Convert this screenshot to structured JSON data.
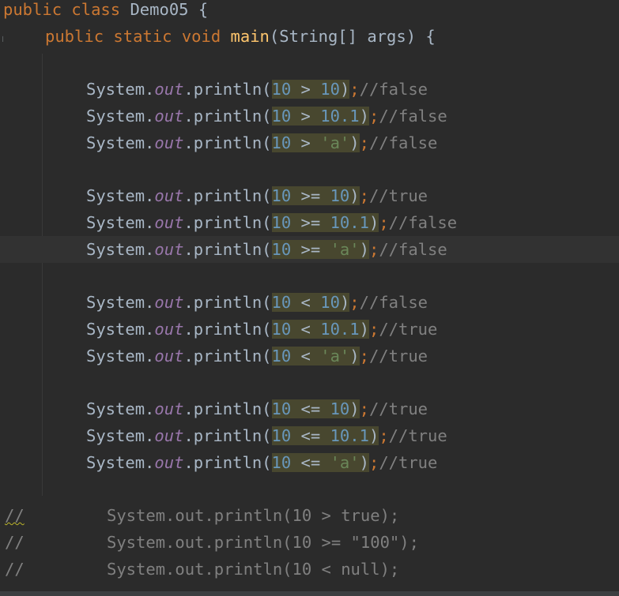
{
  "editor": {
    "class_decl": {
      "kw_public": "public",
      "kw_class": "class",
      "name": " Demo05 ",
      "brace": "{"
    },
    "main_decl": {
      "kw_public": "public",
      "kw_static": "static",
      "kw_void": "void",
      "name": "main",
      "params": "(String[] args) {"
    },
    "lines": [
      {
        "recv": "System.",
        "field": "out",
        "call": ".println(",
        "lhs": "10",
        "op": " > ",
        "rhs": "10",
        "rhs_type": "num",
        "close": ")",
        "semi": ";",
        "comment": "//false"
      },
      {
        "recv": "System.",
        "field": "out",
        "call": ".println(",
        "lhs": "10",
        "op": " > ",
        "rhs": "10.1",
        "rhs_type": "num",
        "close": ")",
        "semi": ";",
        "comment": "//false"
      },
      {
        "recv": "System.",
        "field": "out",
        "call": ".println(",
        "lhs": "10",
        "op": " > ",
        "rhs": "'a'",
        "rhs_type": "str",
        "close": ")",
        "semi": ";",
        "comment": "//false"
      },
      {
        "recv": "System.",
        "field": "out",
        "call": ".println(",
        "lhs": "10",
        "op": " >= ",
        "rhs": "10",
        "rhs_type": "num",
        "close": ")",
        "semi": ";",
        "comment": "//true"
      },
      {
        "recv": "System.",
        "field": "out",
        "call": ".println(",
        "lhs": "10",
        "op": " >= ",
        "rhs": "10.1",
        "rhs_type": "num",
        "close": ")",
        "semi": ";",
        "comment": "//false"
      },
      {
        "recv": "System.",
        "field": "out",
        "call": ".println(",
        "lhs": "10",
        "op": " >= ",
        "rhs": "'a'",
        "rhs_type": "str",
        "close": ")",
        "semi": ";",
        "comment": "//false"
      },
      {
        "recv": "System.",
        "field": "out",
        "call": ".println(",
        "lhs": "10",
        "op": " < ",
        "rhs": "10",
        "rhs_type": "num",
        "close": ")",
        "semi": ";",
        "comment": "//false"
      },
      {
        "recv": "System.",
        "field": "out",
        "call": ".println(",
        "lhs": "10",
        "op": " < ",
        "rhs": "10.1",
        "rhs_type": "num",
        "close": ")",
        "semi": ";",
        "comment": "//true"
      },
      {
        "recv": "System.",
        "field": "out",
        "call": ".println(",
        "lhs": "10",
        "op": " < ",
        "rhs": "'a'",
        "rhs_type": "str",
        "close": ")",
        "semi": ";",
        "comment": "//true"
      },
      {
        "recv": "System.",
        "field": "out",
        "call": ".println(",
        "lhs": "10",
        "op": " <= ",
        "rhs": "10",
        "rhs_type": "num",
        "close": ")",
        "semi": ";",
        "comment": "//true"
      },
      {
        "recv": "System.",
        "field": "out",
        "call": ".println(",
        "lhs": "10",
        "op": " <= ",
        "rhs": "10.1",
        "rhs_type": "num",
        "close": ")",
        "semi": ";",
        "comment": "//true"
      },
      {
        "recv": "System.",
        "field": "out",
        "call": ".println(",
        "lhs": "10",
        "op": " <= ",
        "rhs": "'a'",
        "rhs_type": "str",
        "close": ")",
        "semi": ";",
        "comment": "//true"
      }
    ],
    "commented_lines": [
      {
        "marker": "//",
        "code": "System.out.println(10 > true);"
      },
      {
        "marker": "//",
        "code": "System.out.println(10 >= \"100\");"
      },
      {
        "marker": "//",
        "code": "System.out.println(10 < null);"
      }
    ]
  }
}
